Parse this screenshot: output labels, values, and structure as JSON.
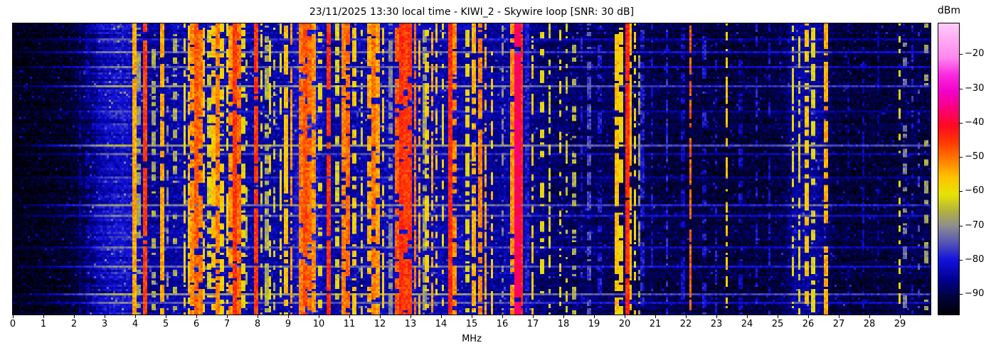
{
  "figure": {
    "title": "23/11/2025 13:30 local time - KIWI_2 - Skywire loop [SNR: 30 dB]",
    "xlabel": "MHz",
    "colorbar_label": "dBm"
  },
  "chart_data": {
    "type": "heatmap",
    "subtype": "radio-spectrogram-waterfall",
    "title": "23/11/2025 13:30 local time - KIWI_2 - Skywire loop [SNR: 30 dB]",
    "xlabel": "MHz",
    "ylabel": "",
    "x_range_mhz": [
      0,
      30
    ],
    "x_ticks": [
      "0",
      "1",
      "2",
      "3",
      "4",
      "5",
      "6",
      "7",
      "8",
      "9",
      "10",
      "11",
      "12",
      "13",
      "14",
      "15",
      "16",
      "17",
      "18",
      "19",
      "20",
      "21",
      "22",
      "23",
      "24",
      "25",
      "26",
      "27",
      "28",
      "29"
    ],
    "grid": false,
    "colorbar": {
      "label": "dBm",
      "position": "right",
      "vmin_dbm": -96,
      "vmax_dbm": -11,
      "ticks": [
        {
          "value": -20,
          "label": "−20"
        },
        {
          "value": -30,
          "label": "−30"
        },
        {
          "value": -40,
          "label": "−40"
        },
        {
          "value": -50,
          "label": "−50"
        },
        {
          "value": -60,
          "label": "−60"
        },
        {
          "value": -70,
          "label": "−70"
        },
        {
          "value": -80,
          "label": "−80"
        },
        {
          "value": -90,
          "label": "−90"
        }
      ],
      "stops": [
        [
          0.0,
          "#000004"
        ],
        [
          0.059,
          "#02023a"
        ],
        [
          0.118,
          "#00008f"
        ],
        [
          0.188,
          "#1212dd"
        ],
        [
          0.247,
          "#5555b5"
        ],
        [
          0.306,
          "#8e8e8e"
        ],
        [
          0.353,
          "#b0b040"
        ],
        [
          0.412,
          "#e6e305"
        ],
        [
          0.471,
          "#ffc300"
        ],
        [
          0.529,
          "#ff8000"
        ],
        [
          0.588,
          "#ff3c00"
        ],
        [
          0.647,
          "#ff0a20"
        ],
        [
          0.706,
          "#fa0078"
        ],
        [
          0.765,
          "#f200c8"
        ],
        [
          0.824,
          "#fb2ae0"
        ],
        [
          0.882,
          "#ff86ef"
        ],
        [
          1.0,
          "#ffccf6"
        ]
      ]
    },
    "noise_floor_profile_mhz_dbm": [
      [
        0,
        -94
      ],
      [
        0.8,
        -93.5
      ],
      [
        1.8,
        -92.5
      ],
      [
        2.4,
        -89
      ],
      [
        2.8,
        -83
      ],
      [
        3.3,
        -80.5
      ],
      [
        3.9,
        -81
      ],
      [
        4.3,
        -85.5
      ],
      [
        4.8,
        -85
      ],
      [
        5.4,
        -83.5
      ],
      [
        6.5,
        -83
      ],
      [
        7.5,
        -83.5
      ],
      [
        8.2,
        -84
      ],
      [
        9.0,
        -84
      ],
      [
        9.4,
        -79
      ],
      [
        9.9,
        -80
      ],
      [
        10.2,
        -84.5
      ],
      [
        11.0,
        -84
      ],
      [
        12.0,
        -83
      ],
      [
        12.9,
        -81.5
      ],
      [
        13.5,
        -83
      ],
      [
        14.3,
        -83.5
      ],
      [
        15.0,
        -84
      ],
      [
        15.8,
        -85
      ],
      [
        16.5,
        -83
      ],
      [
        17.0,
        -86.5
      ],
      [
        17.6,
        -88
      ],
      [
        18.5,
        -88.5
      ],
      [
        19.5,
        -89
      ],
      [
        20.5,
        -89.5
      ],
      [
        21.5,
        -90.5
      ],
      [
        23.0,
        -91
      ],
      [
        24.5,
        -91
      ],
      [
        25.2,
        -90
      ],
      [
        25.5,
        -84.5
      ],
      [
        26.0,
        -84
      ],
      [
        26.45,
        -86
      ],
      [
        26.8,
        -91
      ],
      [
        27.5,
        -91.5
      ],
      [
        28.6,
        -91
      ],
      [
        29.1,
        -90
      ],
      [
        30,
        -90.5
      ]
    ],
    "signals_mhz_width_dbm_duty": [
      [
        2.2,
        0.04,
        -86,
        0.6
      ],
      [
        2.45,
        0.04,
        -85,
        0.55
      ],
      [
        3.6,
        0.04,
        -81,
        0.7
      ],
      [
        3.95,
        0.07,
        -54,
        0.95
      ],
      [
        4.12,
        0.04,
        -68,
        0.5
      ],
      [
        4.33,
        0.05,
        -46,
        0.92
      ],
      [
        4.62,
        0.04,
        -67,
        0.45
      ],
      [
        4.87,
        0.06,
        -54,
        0.93
      ],
      [
        5.05,
        0.03,
        -70,
        0.4
      ],
      [
        5.3,
        0.04,
        -66,
        0.5
      ],
      [
        5.62,
        0.04,
        -60,
        0.6
      ],
      [
        5.75,
        0.05,
        -56,
        0.8
      ],
      [
        5.88,
        0.05,
        -52,
        0.85
      ],
      [
        6.0,
        0.07,
        -48,
        0.9
      ],
      [
        6.12,
        0.06,
        -50,
        0.85
      ],
      [
        6.25,
        0.05,
        -58,
        0.6
      ],
      [
        6.4,
        0.04,
        -62,
        0.5
      ],
      [
        6.55,
        0.05,
        -56,
        0.7
      ],
      [
        6.7,
        0.06,
        -51,
        0.85
      ],
      [
        6.85,
        0.04,
        -58,
        0.6
      ],
      [
        7.0,
        0.04,
        -60,
        0.55
      ],
      [
        7.12,
        0.05,
        -52,
        0.8
      ],
      [
        7.25,
        0.07,
        -45,
        0.95
      ],
      [
        7.38,
        0.05,
        -49,
        0.85
      ],
      [
        7.52,
        0.04,
        -60,
        0.5
      ],
      [
        7.65,
        0.03,
        -64,
        0.4
      ],
      [
        7.95,
        0.07,
        -45,
        0.95
      ],
      [
        8.12,
        0.04,
        -62,
        0.5
      ],
      [
        8.3,
        0.05,
        -66,
        0.6
      ],
      [
        8.4,
        0.04,
        -59,
        0.5
      ],
      [
        8.55,
        0.04,
        -64,
        0.45
      ],
      [
        8.75,
        0.04,
        -60,
        0.5
      ],
      [
        8.95,
        0.05,
        -56,
        0.7
      ],
      [
        9.1,
        0.05,
        -53,
        0.75
      ],
      [
        9.45,
        0.08,
        -50,
        0.9
      ],
      [
        9.58,
        0.07,
        -47,
        0.9
      ],
      [
        9.72,
        0.06,
        -49,
        0.85
      ],
      [
        9.85,
        0.06,
        -52,
        0.8
      ],
      [
        10.05,
        0.04,
        -60,
        0.5
      ],
      [
        10.35,
        0.05,
        -45,
        0.92
      ],
      [
        10.6,
        0.04,
        -62,
        0.5
      ],
      [
        10.8,
        0.05,
        -51,
        0.8
      ],
      [
        10.95,
        0.05,
        -49,
        0.8
      ],
      [
        11.15,
        0.04,
        -57,
        0.6
      ],
      [
        11.4,
        0.04,
        -63,
        0.45
      ],
      [
        11.65,
        0.05,
        -54,
        0.7
      ],
      [
        11.8,
        0.06,
        -50,
        0.85
      ],
      [
        11.95,
        0.05,
        -53,
        0.75
      ],
      [
        12.1,
        0.04,
        -57,
        0.6
      ],
      [
        12.35,
        0.04,
        -70,
        0.6
      ],
      [
        12.55,
        0.06,
        -48,
        0.85
      ],
      [
        12.7,
        0.07,
        -44,
        0.92
      ],
      [
        12.85,
        0.06,
        -46,
        0.9
      ],
      [
        13.0,
        0.06,
        -45,
        0.9
      ],
      [
        13.15,
        0.05,
        -50,
        0.8
      ],
      [
        13.3,
        0.04,
        -55,
        0.65
      ],
      [
        13.45,
        0.04,
        -68,
        0.7
      ],
      [
        13.55,
        0.04,
        -58,
        0.55
      ],
      [
        13.7,
        0.05,
        -54,
        0.6
      ],
      [
        13.85,
        0.04,
        -57,
        0.55
      ],
      [
        14.05,
        0.04,
        -60,
        0.5
      ],
      [
        14.28,
        0.09,
        -44,
        0.95
      ],
      [
        14.45,
        0.05,
        -52,
        0.7
      ],
      [
        14.85,
        0.04,
        -60,
        0.5
      ],
      [
        15.05,
        0.05,
        -55,
        0.65
      ],
      [
        15.25,
        0.06,
        -51,
        0.8
      ],
      [
        15.45,
        0.05,
        -54,
        0.7
      ],
      [
        15.65,
        0.04,
        -57,
        0.55
      ],
      [
        16.0,
        0.03,
        -70,
        0.4
      ],
      [
        16.33,
        0.05,
        -52,
        0.9
      ],
      [
        16.5,
        0.15,
        -37,
        0.97
      ],
      [
        16.63,
        0.04,
        -44,
        0.9
      ],
      [
        16.8,
        0.04,
        -80,
        0.8
      ],
      [
        17.0,
        0.04,
        -57,
        0.6
      ],
      [
        17.3,
        0.04,
        -60,
        0.55
      ],
      [
        17.55,
        0.04,
        -62,
        0.5
      ],
      [
        17.9,
        0.04,
        -58,
        0.35
      ],
      [
        18.1,
        0.03,
        -63,
        0.3
      ],
      [
        18.35,
        0.03,
        -66,
        0.3
      ],
      [
        18.6,
        0.03,
        -80,
        0.5
      ],
      [
        18.85,
        0.03,
        -76,
        0.6
      ],
      [
        19.2,
        0.03,
        -80,
        0.5
      ],
      [
        19.74,
        0.04,
        -56,
        0.9
      ],
      [
        19.88,
        0.04,
        -59,
        0.6
      ],
      [
        20.1,
        0.04,
        -44,
        0.95
      ],
      [
        20.2,
        0.04,
        -56,
        0.85
      ],
      [
        20.33,
        0.04,
        -58,
        0.6
      ],
      [
        20.47,
        0.03,
        -68,
        0.5
      ],
      [
        20.6,
        0.04,
        -80,
        0.7
      ],
      [
        20.9,
        0.03,
        -81,
        0.5
      ],
      [
        21.4,
        0.03,
        -79,
        0.6
      ],
      [
        21.9,
        0.03,
        -82,
        0.5
      ],
      [
        22.15,
        0.05,
        -49,
        0.9
      ],
      [
        22.6,
        0.03,
        -80,
        0.5
      ],
      [
        23.0,
        0.03,
        -81,
        0.5
      ],
      [
        23.35,
        0.04,
        -57,
        0.55
      ],
      [
        23.8,
        0.03,
        -82,
        0.5
      ],
      [
        24.3,
        0.03,
        -80,
        0.5
      ],
      [
        24.75,
        0.03,
        -81,
        0.5
      ],
      [
        25.5,
        0.04,
        -60,
        0.55
      ],
      [
        25.72,
        0.04,
        -62,
        0.5
      ],
      [
        25.95,
        0.05,
        -57,
        0.6
      ],
      [
        26.18,
        0.04,
        -61,
        0.5
      ],
      [
        26.6,
        0.04,
        -54,
        0.8
      ],
      [
        27.3,
        0.03,
        -85,
        0.4
      ],
      [
        27.8,
        0.03,
        -83,
        0.4
      ],
      [
        28.3,
        0.03,
        -85,
        0.35
      ],
      [
        29.0,
        0.04,
        -60,
        0.3
      ],
      [
        29.15,
        0.03,
        -72,
        0.35
      ],
      [
        29.4,
        0.03,
        -80,
        0.35
      ],
      [
        29.6,
        0.03,
        -76,
        0.3
      ],
      [
        29.85,
        0.03,
        -68,
        0.3
      ]
    ],
    "broadband_time_streaks_frac_boost_db": [
      [
        0.05,
        6
      ],
      [
        0.095,
        10
      ],
      [
        0.144,
        9
      ],
      [
        0.212,
        13
      ],
      [
        0.3,
        5
      ],
      [
        0.42,
        15
      ],
      [
        0.445,
        7
      ],
      [
        0.53,
        5
      ],
      [
        0.627,
        12
      ],
      [
        0.663,
        9
      ],
      [
        0.773,
        8
      ],
      [
        0.84,
        10
      ],
      [
        0.932,
        14
      ],
      [
        0.963,
        9
      ]
    ],
    "render": {
      "cols": 430,
      "rows": 137,
      "seed": 73
    }
  }
}
